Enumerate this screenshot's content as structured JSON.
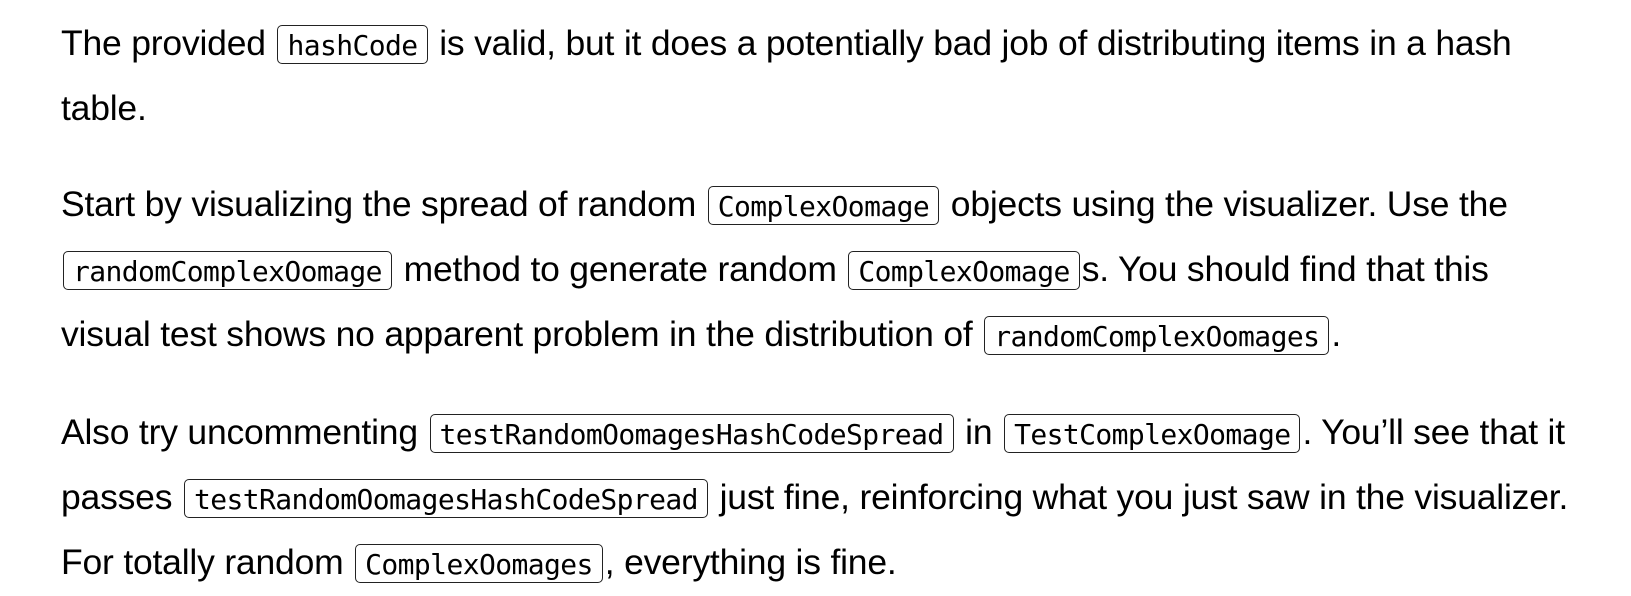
{
  "paragraphs": [
    {
      "segments": [
        {
          "t": "text",
          "v": "The provided "
        },
        {
          "t": "code",
          "v": "hashCode"
        },
        {
          "t": "text",
          "v": " is valid, but it does a potentially bad job of distributing items in a hash table."
        }
      ]
    },
    {
      "segments": [
        {
          "t": "text",
          "v": "Start by visualizing the spread of random "
        },
        {
          "t": "code",
          "v": "ComplexOomage"
        },
        {
          "t": "text",
          "v": " objects using the visualizer. Use the "
        },
        {
          "t": "code",
          "v": "randomComplexOomage"
        },
        {
          "t": "text",
          "v": " method to generate random "
        },
        {
          "t": "code",
          "v": "ComplexOomage"
        },
        {
          "t": "text",
          "v": "s. You should find that this visual test shows no apparent problem in the distribution of "
        },
        {
          "t": "code",
          "v": "randomComplexOomages"
        },
        {
          "t": "text",
          "v": "."
        }
      ]
    },
    {
      "segments": [
        {
          "t": "text",
          "v": "Also try uncommenting "
        },
        {
          "t": "code",
          "v": "testRandomOomagesHashCodeSpread"
        },
        {
          "t": "text",
          "v": " in "
        },
        {
          "t": "code",
          "v": "TestComplexOomage"
        },
        {
          "t": "text",
          "v": ". You’ll see that it passes "
        },
        {
          "t": "code",
          "v": "testRandomOomagesHashCodeSpread"
        },
        {
          "t": "text",
          "v": " just fine, reinforcing what you just saw in the visualizer. For totally random "
        },
        {
          "t": "code",
          "v": "ComplexOomages"
        },
        {
          "t": "text",
          "v": ", everything is fine."
        }
      ]
    }
  ]
}
